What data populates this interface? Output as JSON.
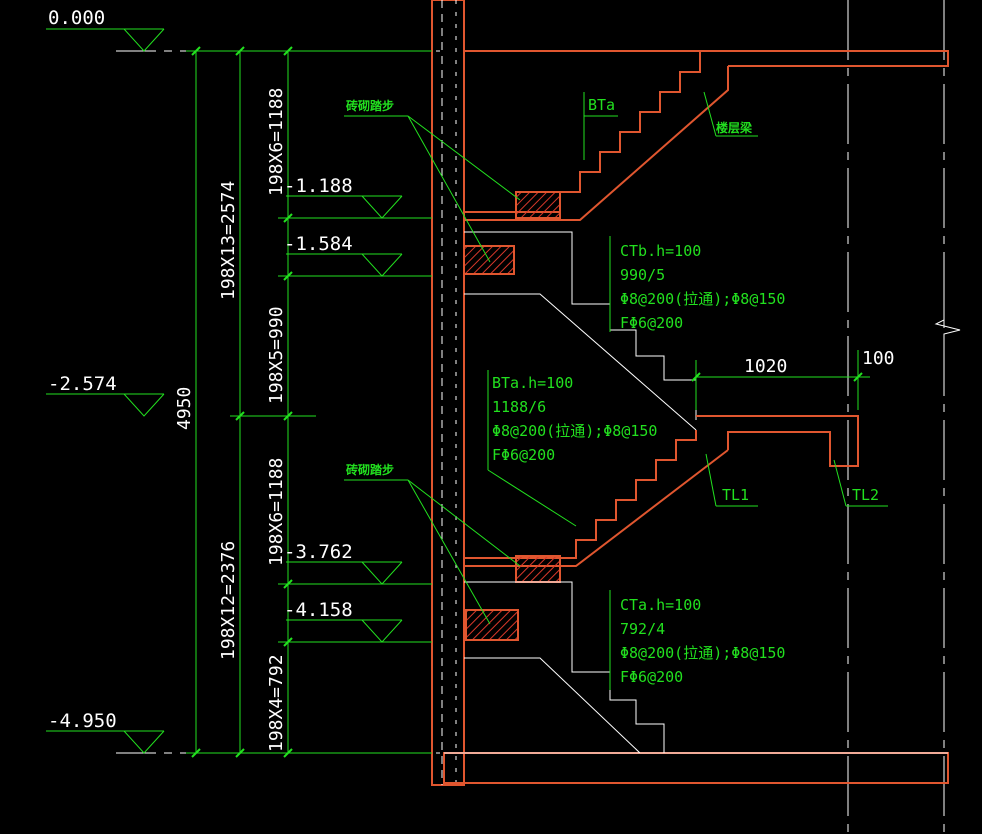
{
  "colors": {
    "background": "#000000",
    "text": "#ffffff",
    "dimension_line": "#22e01f",
    "concrete_outline": "#e0562f",
    "hatch_fill": "#b8251c",
    "leader": "#22e01f",
    "centerline": "#ffffff"
  },
  "elevations": {
    "e0": "0.000",
    "e1": "-1.188",
    "e2": "-1.584",
    "e3": "-2.574",
    "e4": "-3.762",
    "e5": "-4.158",
    "e6": "-4.950"
  },
  "dimensions": {
    "total": "4950",
    "upper": "198X13=2574",
    "lower": "198X12=2376",
    "d1": "198X6=1188",
    "d2": "198X5=990",
    "d3": "198X6=1188",
    "d4": "198X4=792",
    "landing": "1020",
    "beam": "100"
  },
  "labels": {
    "brick_step_1": "砖砌踏步",
    "brick_step_2": "砖砌踏步",
    "floor_beam": "楼层梁",
    "bta_top": "BTa",
    "tl1": "TL1",
    "tl2": "TL2"
  },
  "notes": {
    "ctb": [
      "CTb.h=100",
      "990/5",
      "Φ8@200(拉通);Φ8@150",
      "FΦ6@200"
    ],
    "bta": [
      "BTa.h=100",
      "1188/6",
      "Φ8@200(拉通);Φ8@150",
      "FΦ6@200"
    ],
    "cta": [
      "CTa.h=100",
      "792/4",
      "Φ8@200(拉通);Φ8@150",
      "FΦ6@200"
    ]
  }
}
